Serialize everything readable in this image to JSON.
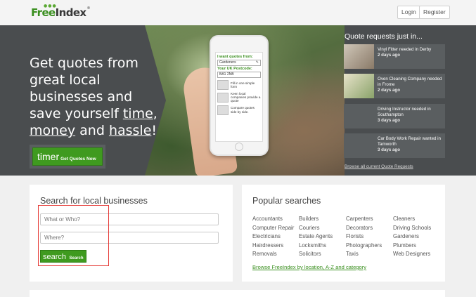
{
  "header": {
    "logo_free": "Free",
    "logo_index": "Index",
    "login_label": "Login",
    "register_label": "Register"
  },
  "hero": {
    "headline_line1": "Get quotes from great local businesses and save yourself ",
    "headline_time": "time",
    "headline_comma": ",",
    "headline_money": "money",
    "headline_and": " and ",
    "headline_hassle": "hassle",
    "headline_bang": "!",
    "cta_big": "timer",
    "cta_small": "Get Quotes Now",
    "phone": {
      "want_label": "I want quotes from:",
      "want_value": "Gardeners",
      "postcode_label": "Your UK Postcode:",
      "postcode_value": "BA1 2NB",
      "steps": [
        "Fill in one simple form",
        "Keen local companies provide a quote",
        "Compare quotes side by side."
      ]
    }
  },
  "quote_requests": {
    "title": "Quote requests just in...",
    "items": [
      {
        "text": "Vinyl Fitter needed in Derby",
        "ago": "2 days ago"
      },
      {
        "text": "Oven Cleaning Company needed in Frome",
        "ago": "2 days ago"
      },
      {
        "text": "Driving Instructor needed in Southampton",
        "ago": "3 days ago"
      },
      {
        "text": "Car Body Work Repair wanted in Tamworth",
        "ago": "3 days ago"
      }
    ],
    "browse_link": "Browse all current Quote Requests"
  },
  "search": {
    "title": "Search for local businesses",
    "what_placeholder": "What or Who?",
    "where_placeholder": "Where?",
    "btn_big": "search",
    "btn_small": "Search"
  },
  "popular": {
    "title": "Popular searches",
    "columns": [
      [
        "Accountants",
        "Computer Repair",
        "Electricians",
        "Hairdressers",
        "Removals"
      ],
      [
        "Builders",
        "Couriers",
        "Estate Agents",
        "Locksmiths",
        "Solicitors"
      ],
      [
        "Carpenters",
        "Decorators",
        "Florists",
        "Photographers",
        "Taxis"
      ],
      [
        "Cleaners",
        "Driving Schools",
        "Gardeners",
        "Plumbers",
        "Web Designers"
      ]
    ],
    "browse_link": "Browse FreeIndex by location, A-Z and category"
  },
  "colors": {
    "brand_green": "#3f9a1f",
    "hero_bg": "#4a4d4f",
    "highlight_red": "#e53935"
  }
}
